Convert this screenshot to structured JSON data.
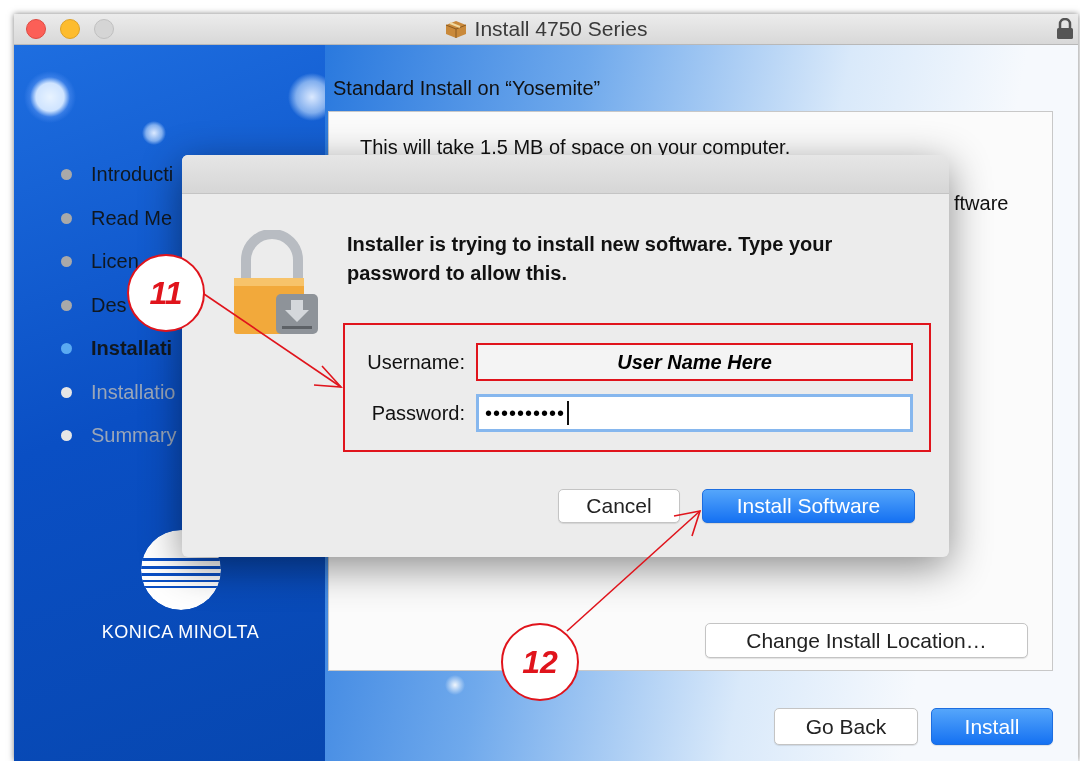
{
  "window": {
    "title": "Install 4750 Series"
  },
  "sidebar": {
    "items": [
      {
        "label": "Introducti",
        "selected": false,
        "disabled": false
      },
      {
        "label": "Read Me",
        "selected": false,
        "disabled": false
      },
      {
        "label": "Licen",
        "selected": false,
        "disabled": false
      },
      {
        "label": "Des",
        "selected": false,
        "disabled": false
      },
      {
        "label": "Installati",
        "selected": true,
        "disabled": false
      },
      {
        "label": "Installatio",
        "selected": false,
        "disabled": true
      },
      {
        "label": "Summary",
        "selected": false,
        "disabled": true
      }
    ],
    "logo_text": "KONICA MINOLTA"
  },
  "content": {
    "heading": "Standard Install on “Yosemite”",
    "lines": [
      "This will take 1.5 MB of space on your computer.",
      "ftware"
    ],
    "change_location_button": "Change Install Location…"
  },
  "buttons": [
    {
      "label": "Go Back",
      "default": false
    },
    {
      "label": "Install",
      "default": true
    }
  ],
  "dialog": {
    "message": "Installer is trying to install new software. Type your password to allow this.",
    "fields": [
      {
        "label": "Username:",
        "value": "User Name Here",
        "focused": false,
        "highlighted": true
      },
      {
        "label": "Password:",
        "value": "••••••••••",
        "focused": true,
        "highlighted": false
      }
    ],
    "buttons": [
      {
        "label": "Cancel",
        "default": false
      },
      {
        "label": "Install Software",
        "default": true
      }
    ]
  },
  "annotations": [
    {
      "number": "11"
    },
    {
      "number": "12"
    }
  ]
}
